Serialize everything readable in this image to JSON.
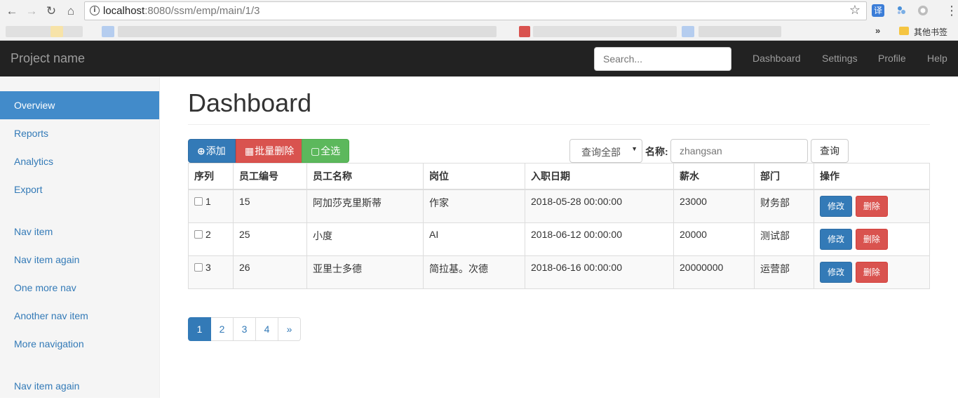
{
  "browser": {
    "url_host": "localhost",
    "url_path": ":8080/ssm/emp/main/1/3",
    "bookmarks_other": "其他书签",
    "bookmarks_more": "»",
    "ext_translate": "译"
  },
  "navbar": {
    "brand": "Project name",
    "search_placeholder": "Search...",
    "links": [
      "Dashboard",
      "Settings",
      "Profile",
      "Help"
    ]
  },
  "sidebar": {
    "groups": [
      [
        "Overview",
        "Reports",
        "Analytics",
        "Export"
      ],
      [
        "Nav item",
        "Nav item again",
        "One more nav",
        "Another nav item",
        "More navigation"
      ],
      [
        "Nav item again"
      ]
    ],
    "active": "Overview"
  },
  "main": {
    "title": "Dashboard",
    "toolbar": {
      "add": "添加",
      "batch_delete": "批量删除",
      "select_all": "全选"
    },
    "filter": {
      "select_value": "查询全部",
      "name_label": "名称:",
      "name_placeholder": "zhangsan",
      "query_button": "查询"
    },
    "table": {
      "headers": [
        "序列",
        "员工编号",
        "员工名称",
        "岗位",
        "入职日期",
        "薪水",
        "部门",
        "操作"
      ],
      "rows": [
        {
          "index": "1",
          "emp_id": "15",
          "name": "阿加莎克里斯蒂",
          "position": "作家",
          "hire_date": "2018-05-28 00:00:00",
          "salary": "23000",
          "dept": "财务部"
        },
        {
          "index": "2",
          "emp_id": "25",
          "name": "小度",
          "position": "AI",
          "hire_date": "2018-06-12 00:00:00",
          "salary": "20000",
          "dept": "测试部"
        },
        {
          "index": "3",
          "emp_id": "26",
          "name": "亚里士多德",
          "position": "简拉基。次德",
          "hire_date": "2018-06-16 00:00:00",
          "salary": "20000000",
          "dept": "运营部"
        }
      ],
      "edit_label": "修改",
      "delete_label": "删除"
    },
    "pagination": {
      "pages": [
        "1",
        "2",
        "3",
        "4"
      ],
      "next": "»",
      "active": "1"
    }
  }
}
